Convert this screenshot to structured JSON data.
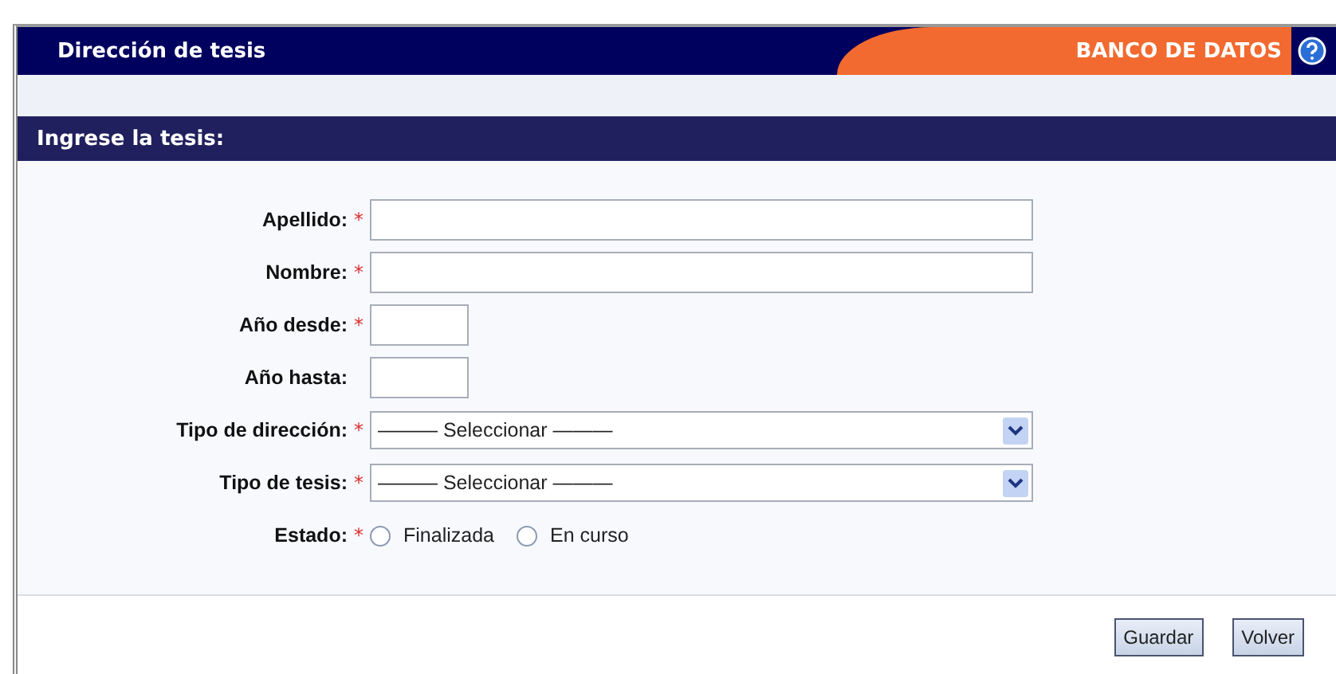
{
  "header": {
    "title": "Dirección de tesis",
    "brand": "BANCO DE DATOS"
  },
  "section": {
    "title": "Ingrese la tesis:"
  },
  "fields": [
    {
      "kind": "text",
      "label": "Apellido:",
      "required_mark": "*"
    },
    {
      "kind": "text",
      "label": "Nombre:",
      "required_mark": "*"
    },
    {
      "kind": "year",
      "label": "Año desde:",
      "required_mark": "*"
    },
    {
      "kind": "year",
      "label": "Año hasta:"
    },
    {
      "kind": "select",
      "label": "Tipo de dirección:",
      "required_mark": "*",
      "value": "——— Seleccionar ———"
    },
    {
      "kind": "select",
      "label": "Tipo de tesis:",
      "required_mark": "*",
      "value": "——— Seleccionar ———"
    },
    {
      "kind": "radio",
      "label": "Estado:",
      "required_mark": "*",
      "options": [
        {
          "label": "Finalizada",
          "selected": false
        },
        {
          "label": "En curso",
          "selected": false
        }
      ]
    }
  ],
  "buttons": [
    "Guardar",
    "Volver"
  ]
}
